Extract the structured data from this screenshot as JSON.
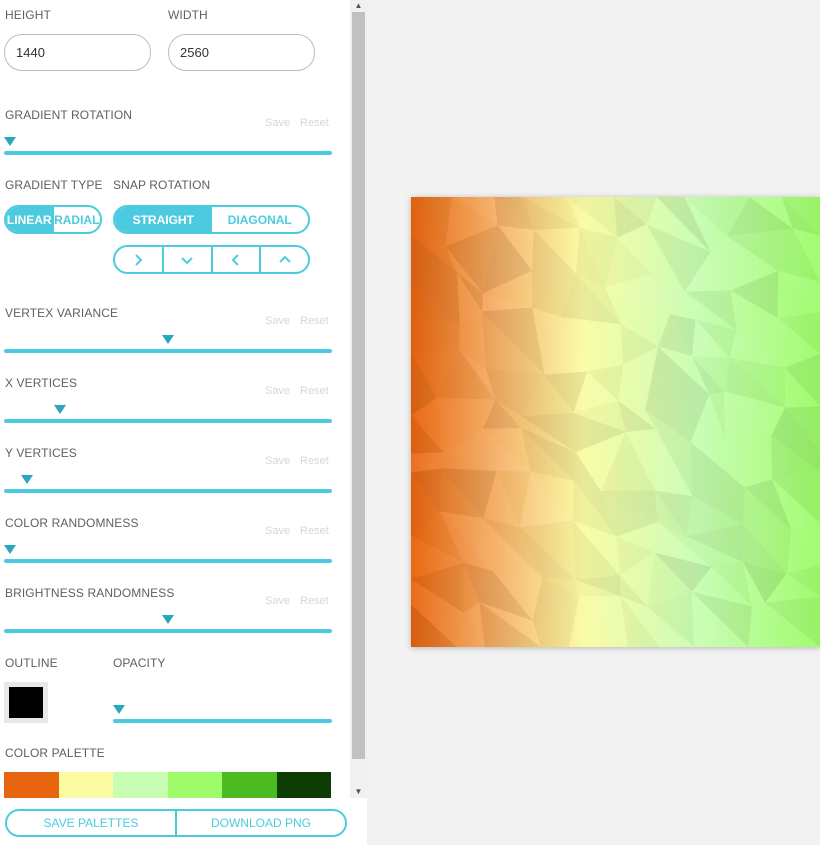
{
  "height": {
    "label": "HEIGHT",
    "value": "1440"
  },
  "width": {
    "label": "WIDTH",
    "value": "2560"
  },
  "save_label": "Save",
  "reset_label": "Reset",
  "gradient_rotation": {
    "label": "GRADIENT ROTATION",
    "level": 0.0
  },
  "gradient_type": {
    "label": "GRADIENT TYPE",
    "options": [
      "LINEAR",
      "RADIAL"
    ],
    "selected": "LINEAR"
  },
  "snap_rotation": {
    "label": "SNAP ROTATION",
    "options": [
      "STRAIGHT",
      "DIAGONAL"
    ],
    "selected": "STRAIGHT",
    "directions": [
      "chevron-right-icon",
      "chevron-down-icon",
      "chevron-left-icon",
      "chevron-up-icon"
    ]
  },
  "vertex_variance": {
    "label": "VERTEX VARIANCE",
    "level": 0.5
  },
  "x_vertices": {
    "label": "X VERTICES",
    "level": 0.17
  },
  "y_vertices": {
    "label": "Y VERTICES",
    "level": 0.07
  },
  "color_randomness": {
    "label": "COLOR RANDOMNESS",
    "level": 0.0
  },
  "brightness_randomness": {
    "label": "BRIGHTNESS RANDOMNESS",
    "level": 0.5
  },
  "outline": {
    "label": "OUTLINE",
    "color": "#000000"
  },
  "opacity": {
    "label": "OPACITY",
    "level": 0.0
  },
  "color_palette": {
    "label": "COLOR PALETTE",
    "colors": [
      "#e8650f",
      "#fbfba4",
      "#c8fdb3",
      "#9efb6a",
      "#4cbb22",
      "#0d3d05"
    ]
  },
  "buttons": {
    "save_palettes": "SAVE PALETTES",
    "download_png": "DOWNLOAD PNG"
  },
  "accent_color": "#4ccbe0",
  "preview_gradient": [
    "#e8650f",
    "#f5b36a",
    "#fbfba4",
    "#c8fdb3",
    "#9efb6a"
  ]
}
